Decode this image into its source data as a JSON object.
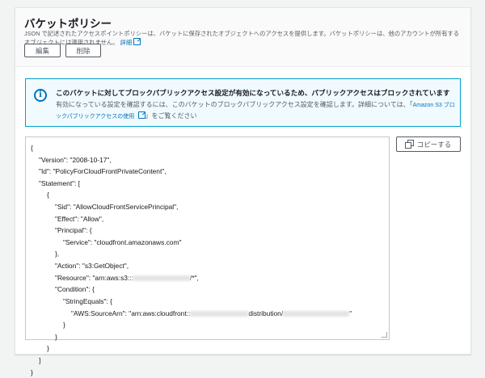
{
  "header": {
    "title": "バケットポリシー",
    "description": "JSON で記述されたアクセスポイントポリシーは、バケットに保存されたオブジェクトへのアクセスを提供します。バケットポリシーは、他のアカウントが所有するオブジェクトには適用されません。",
    "learn_more": "詳細",
    "edit_label": "編集",
    "delete_label": "削除"
  },
  "alert": {
    "title": "このバケットに対してブロックパブリックアクセス設定が有効になっているため、パブリックアクセスはブロックされています",
    "body": "有効になっている設定を確認するには、このバケットのブロックパブリックアクセス設定を確認します。詳細については、「",
    "link": "Amazon S3 ブロックパブリックアクセスの使用",
    "suffix": "」をご覧ください"
  },
  "copy_label": "コピーする",
  "policy_lines": [
    {
      "indent": 0,
      "parts": [
        {
          "t": "{"
        }
      ]
    },
    {
      "indent": 1,
      "parts": [
        {
          "t": "\"Version\": \"2008-10-17\","
        }
      ]
    },
    {
      "indent": 1,
      "parts": [
        {
          "t": "\"Id\": \"PolicyForCloudFrontPrivateContent\","
        }
      ]
    },
    {
      "indent": 1,
      "parts": [
        {
          "t": "\"Statement\": ["
        }
      ]
    },
    {
      "indent": 2,
      "parts": [
        {
          "t": "{"
        }
      ]
    },
    {
      "indent": 3,
      "parts": [
        {
          "t": "\"Sid\": \"AllowCloudFrontServicePrincipal\","
        }
      ]
    },
    {
      "indent": 3,
      "parts": [
        {
          "t": "\"Effect\": \"Allow\","
        }
      ]
    },
    {
      "indent": 3,
      "parts": [
        {
          "t": "\"Principal\": {"
        }
      ]
    },
    {
      "indent": 4,
      "parts": [
        {
          "t": "\"Service\": \"cloudfront.amazonaws.com\""
        }
      ]
    },
    {
      "indent": 3,
      "parts": [
        {
          "t": "},"
        }
      ]
    },
    {
      "indent": 3,
      "parts": [
        {
          "t": "\"Action\": \"s3:GetObject\","
        }
      ]
    },
    {
      "indent": 3,
      "parts": [
        {
          "t": "\"Resource\": \"arn:aws:s3:::"
        },
        {
          "r": 0
        },
        {
          "t": "/*\","
        }
      ]
    },
    {
      "indent": 3,
      "parts": [
        {
          "t": "\"Condition\": {"
        }
      ]
    },
    {
      "indent": 4,
      "parts": [
        {
          "t": "\"StringEquals\": {"
        }
      ]
    },
    {
      "indent": 5,
      "parts": [
        {
          "t": "\"AWS:SourceArn\": \"arn:aws:cloudfront::"
        },
        {
          "r": 1
        },
        {
          "t": "distribution/"
        },
        {
          "r": 2
        },
        {
          "t": "\""
        }
      ]
    },
    {
      "indent": 4,
      "parts": [
        {
          "t": "}"
        }
      ]
    },
    {
      "indent": 3,
      "parts": [
        {
          "t": "}"
        }
      ]
    },
    {
      "indent": 2,
      "parts": [
        {
          "t": "}"
        }
      ]
    },
    {
      "indent": 1,
      "parts": [
        {
          "t": "]"
        }
      ]
    },
    {
      "indent": 0,
      "parts": [
        {
          "t": "}"
        }
      ]
    }
  ]
}
